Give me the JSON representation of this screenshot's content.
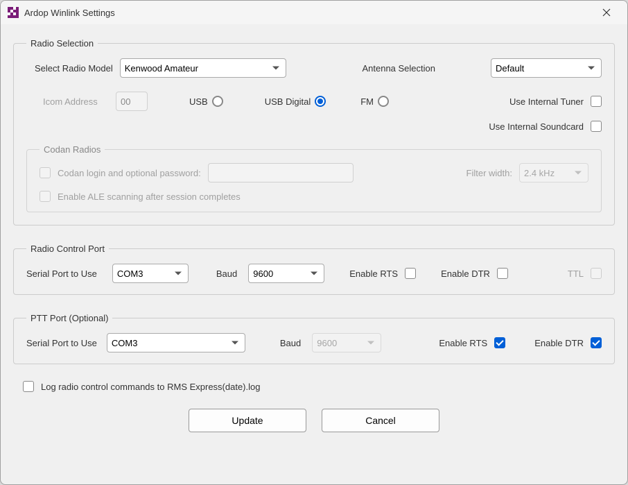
{
  "window": {
    "title": "Ardop Winlink Settings"
  },
  "radioSelection": {
    "legend": "Radio Selection",
    "selectModelLabel": "Select Radio Model",
    "selectedModel": "Kenwood Amateur",
    "antennaLabel": "Antenna Selection",
    "antennaValue": "Default",
    "icomAddrLabel": "Icom Address",
    "icomAddrValue": "00",
    "usbLabel": "USB",
    "usbDigitalLabel": "USB Digital",
    "fmLabel": "FM",
    "useInternalTunerLabel": "Use Internal Tuner",
    "useInternalSoundcardLabel": "Use Internal Soundcard"
  },
  "codan": {
    "legend": "Codan Radios",
    "loginLabel": "Codan login and optional password:",
    "aleLabel": "Enable ALE scanning after session completes",
    "filterWidthLabel": "Filter width:",
    "filterWidthValue": "2.4 kHz"
  },
  "controlPort": {
    "legend": "Radio Control Port",
    "serialLabel": "Serial Port to Use",
    "serialValue": "COM3",
    "baudLabel": "Baud",
    "baudValue": "9600",
    "rtsLabel": "Enable RTS",
    "dtrLabel": "Enable DTR",
    "ttlLabel": "TTL"
  },
  "pttPort": {
    "legend": "PTT Port (Optional)",
    "serialLabel": "Serial Port to Use",
    "serialValue": "COM3",
    "baudLabel": "Baud",
    "baudValue": "9600",
    "rtsLabel": "Enable RTS",
    "dtrLabel": "Enable DTR"
  },
  "logLabel": "Log radio control commands to RMS Express(date).log",
  "buttons": {
    "update": "Update",
    "cancel": "Cancel"
  }
}
